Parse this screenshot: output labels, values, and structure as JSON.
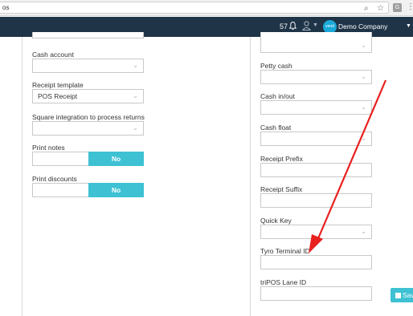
{
  "browser": {
    "url": "os",
    "star": "☆",
    "ext1": "G",
    "ext2": "B",
    "menu": "⋮"
  },
  "header": {
    "notification_count": "57",
    "logo_text": "vend",
    "company": "Demo Company (Global)"
  },
  "left_column": {
    "cash_account_label": "Cash account",
    "cash_account_value": "",
    "receipt_template_label": "Receipt template",
    "receipt_template_value": "POS Receipt",
    "square_label": "Square integration to process returns",
    "square_value": "",
    "print_notes_label": "Print notes",
    "print_notes_value": "No",
    "print_discounts_label": "Print discounts",
    "print_discounts_value": "No"
  },
  "right_column": {
    "petty_cash_label": "Petty cash",
    "cash_in_out_label": "Cash in/out",
    "cash_float_label": "Cash float",
    "receipt_prefix_label": "Receipt Prefix",
    "receipt_suffix_label": "Receipt Suffix",
    "quick_key_label": "Quick Key",
    "tyro_label": "Tyro Terminal ID",
    "tripos_label": "triPOS Lane ID"
  },
  "save_button": {
    "label": "Save"
  },
  "colors": {
    "header_bg": "#1f3447",
    "accent": "#3ec1d3",
    "arrow": "#e8201e"
  }
}
